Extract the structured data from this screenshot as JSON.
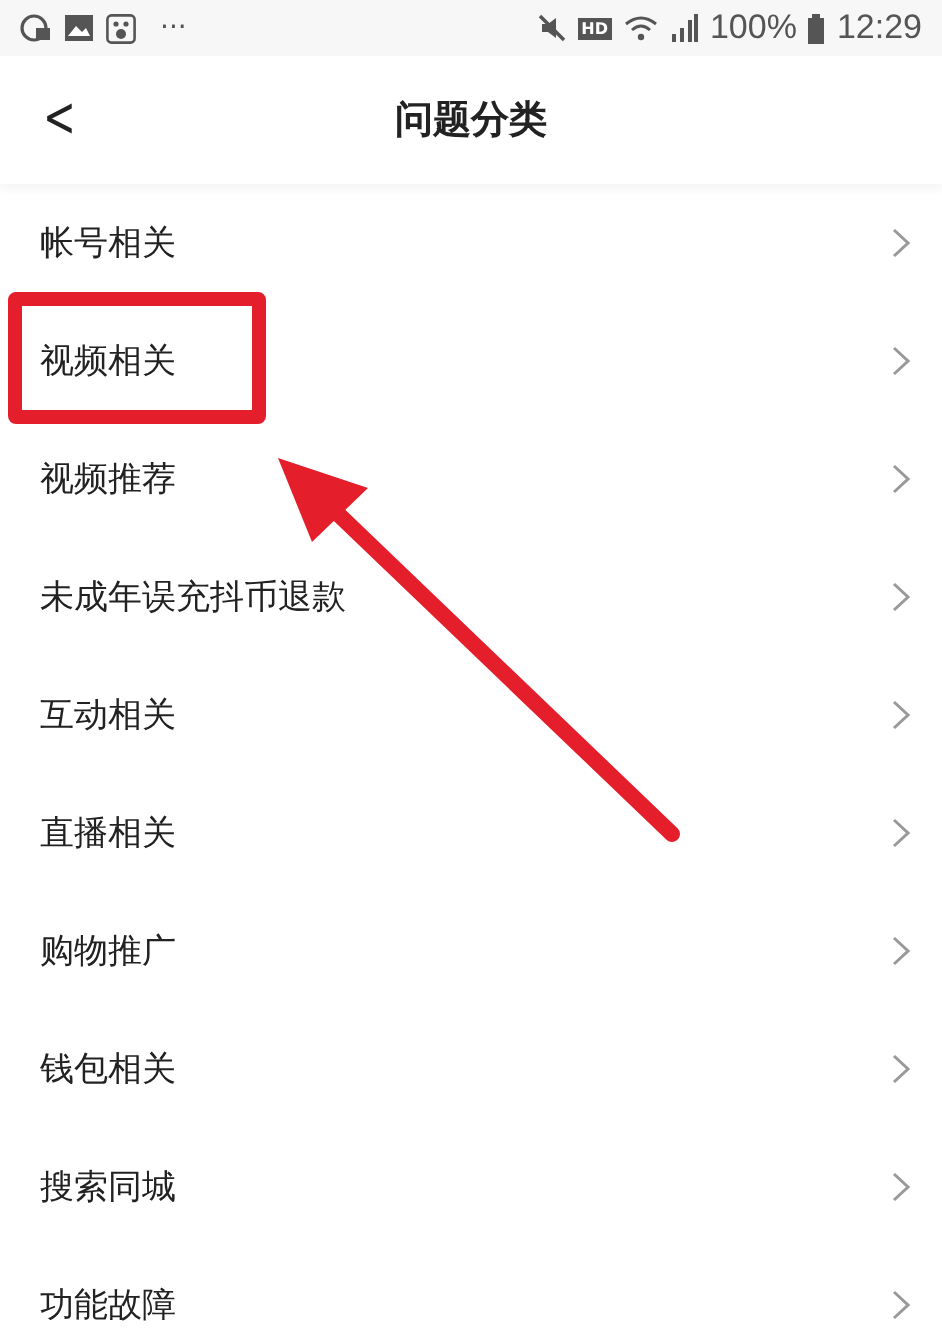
{
  "status_bar": {
    "more": "···",
    "hd": "HD",
    "battery": "100%",
    "time": "12:29"
  },
  "header": {
    "back": "<",
    "title": "问题分类"
  },
  "items": [
    {
      "label": "帐号相关",
      "highlighted": false
    },
    {
      "label": "视频相关",
      "highlighted": true
    },
    {
      "label": "视频推荐",
      "highlighted": false
    },
    {
      "label": "未成年误充抖币退款",
      "highlighted": false
    },
    {
      "label": "互动相关",
      "highlighted": false
    },
    {
      "label": "直播相关",
      "highlighted": false
    },
    {
      "label": "购物推广",
      "highlighted": false
    },
    {
      "label": "钱包相关",
      "highlighted": false
    },
    {
      "label": "搜索同城",
      "highlighted": false
    },
    {
      "label": "功能故障",
      "highlighted": false
    }
  ]
}
